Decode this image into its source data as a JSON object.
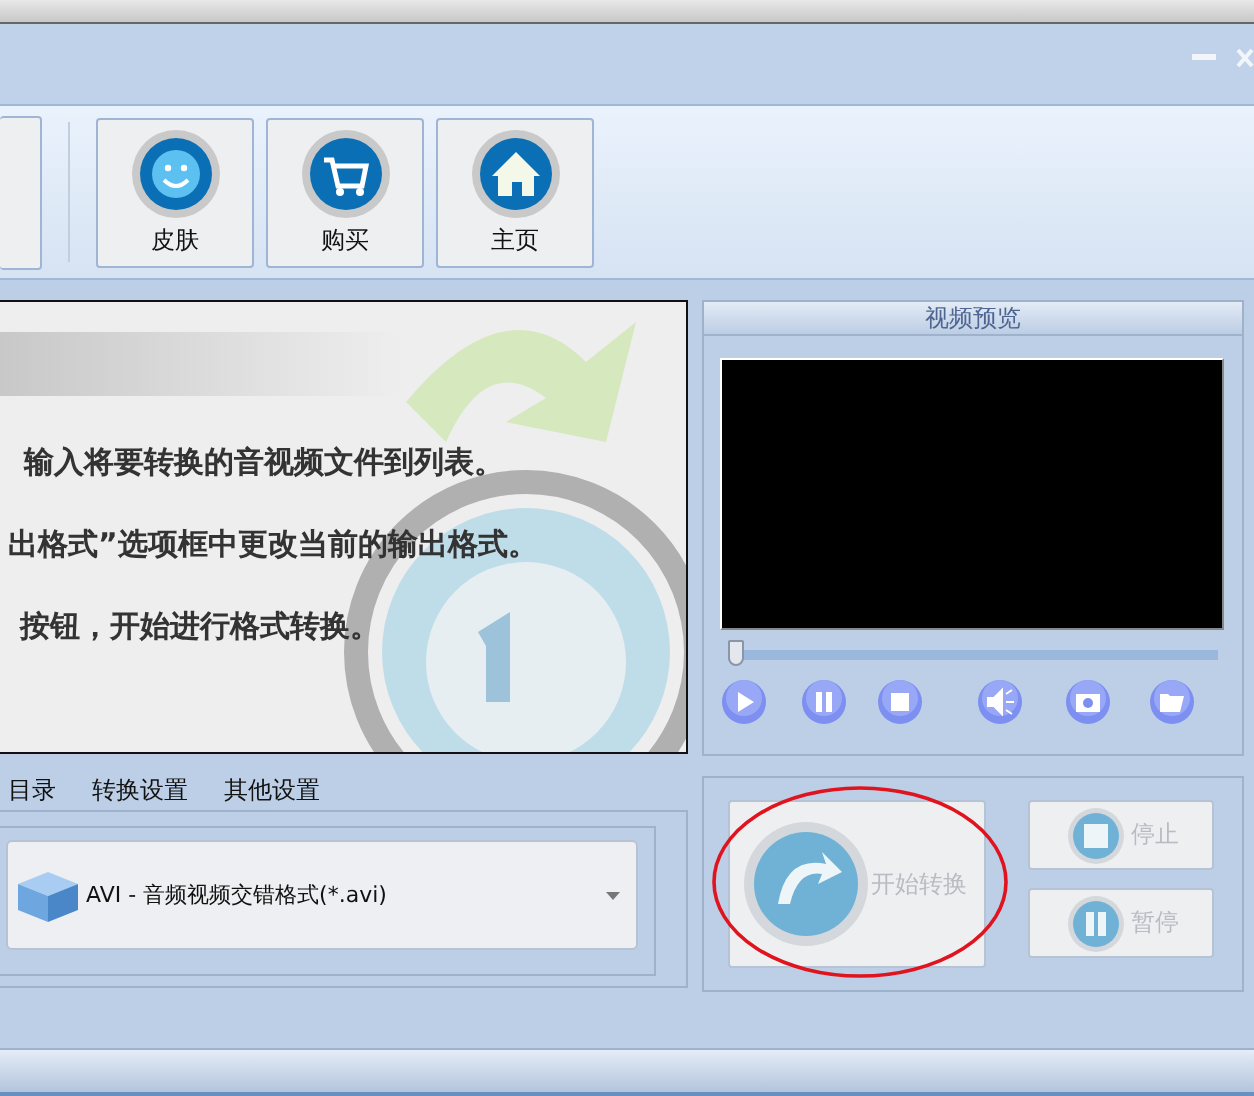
{
  "toolbar": {
    "buttons": [
      {
        "kind": "skin",
        "label": "皮肤"
      },
      {
        "kind": "buy",
        "label": "购买"
      },
      {
        "kind": "home",
        "label": "主页"
      }
    ]
  },
  "intro": {
    "lines": [
      "输入将要转换的音视频文件到列表。",
      "出格式”选项框中更改当前的输出格式。",
      "按钮，开始进行格式转换。"
    ]
  },
  "preview": {
    "title": "视频预览",
    "seek": {
      "level": 0.0
    },
    "controls": [
      {
        "kind": "play"
      },
      {
        "kind": "pause"
      },
      {
        "kind": "stop"
      },
      {
        "kind": "volume"
      },
      {
        "kind": "snapshot"
      },
      {
        "kind": "folder"
      }
    ]
  },
  "tabs": [
    {
      "label": "目录"
    },
    {
      "label": "转换设置"
    },
    {
      "label": "其他设置"
    }
  ],
  "format": {
    "value": "AVI - 音频视频交错格式(*.avi)"
  },
  "actions": {
    "start": {
      "label": "开始转换",
      "disabled": true,
      "circled": true
    },
    "stop": {
      "label": "停止",
      "disabled": true
    },
    "pause": {
      "label": "暂停",
      "disabled": true
    }
  }
}
